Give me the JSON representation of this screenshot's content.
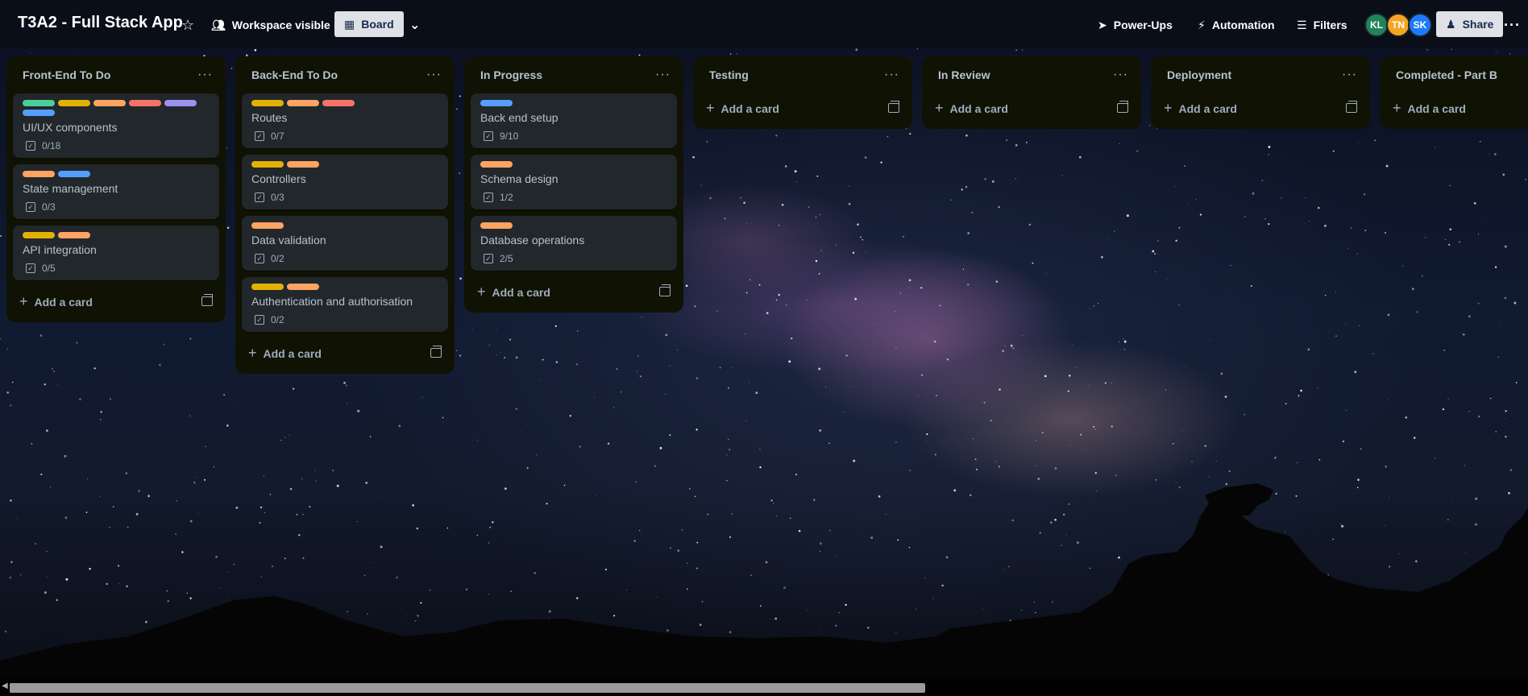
{
  "header": {
    "board_title": "T3A2 - Full Stack App",
    "star_icon": "☆",
    "workspace_label": "Workspace visible",
    "view_label": "Board",
    "powerups_label": "Power-Ups",
    "automation_label": "Automation",
    "filters_label": "Filters",
    "share_label": "Share",
    "members": [
      {
        "initials": "KL",
        "color": "#1f845a"
      },
      {
        "initials": "TN",
        "color": "#f5a524"
      },
      {
        "initials": "SK",
        "color": "#1d7afc"
      }
    ]
  },
  "colors": {
    "green": "#4bce97",
    "yellow": "#e2b203",
    "orange": "#fea362",
    "red": "#f87168",
    "purple": "#9f8fef",
    "blue": "#579dff"
  },
  "lists": [
    {
      "title": "Front-End To Do",
      "add_label": "Add a card",
      "cards": [
        {
          "title": "UI/UX components",
          "checklist": "0/18",
          "labels": [
            "green",
            "yellow",
            "orange",
            "red",
            "purple",
            "blue"
          ]
        },
        {
          "title": "State management",
          "checklist": "0/3",
          "labels": [
            "orange",
            "blue"
          ]
        },
        {
          "title": "API integration",
          "checklist": "0/5",
          "labels": [
            "yellow",
            "orange"
          ]
        }
      ]
    },
    {
      "title": "Back-End To Do",
      "add_label": "Add a card",
      "cards": [
        {
          "title": "Routes",
          "checklist": "0/7",
          "labels": [
            "yellow",
            "orange",
            "red"
          ]
        },
        {
          "title": "Controllers",
          "checklist": "0/3",
          "labels": [
            "yellow",
            "orange"
          ]
        },
        {
          "title": "Data validation",
          "checklist": "0/2",
          "labels": [
            "orange"
          ]
        },
        {
          "title": "Authentication and authorisation",
          "checklist": "0/2",
          "labels": [
            "yellow",
            "orange"
          ]
        }
      ]
    },
    {
      "title": "In Progress",
      "add_label": "Add a card",
      "cards": [
        {
          "title": "Back end setup",
          "checklist": "9/10",
          "labels": [
            "blue"
          ]
        },
        {
          "title": "Schema design",
          "checklist": "1/2",
          "labels": [
            "orange"
          ]
        },
        {
          "title": "Database operations",
          "checklist": "2/5",
          "labels": [
            "orange"
          ]
        }
      ]
    },
    {
      "title": "Testing",
      "add_label": "Add a card",
      "cards": []
    },
    {
      "title": "In Review",
      "add_label": "Add a card",
      "cards": []
    },
    {
      "title": "Deployment",
      "add_label": "Add a card",
      "cards": []
    },
    {
      "title": "Completed - Part B",
      "add_label": "Add a card",
      "cards": []
    }
  ]
}
